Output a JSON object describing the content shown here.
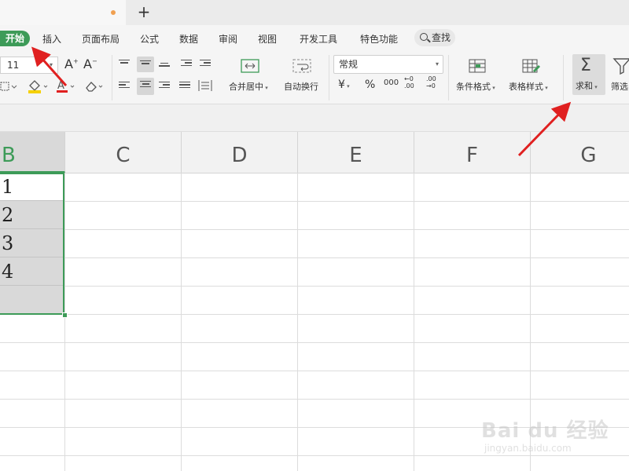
{
  "tabs": {
    "new_tab": "+"
  },
  "menu": {
    "home": "开始",
    "items": [
      "插入",
      "页面布局",
      "公式",
      "数据",
      "审阅",
      "视图",
      "开发工具",
      "特色功能"
    ],
    "search": "查找"
  },
  "ribbon": {
    "font_size": "11",
    "number_format": "常规",
    "merge_center": "合并居中",
    "wrap_text": "自动换行",
    "currency_symbol": "¥",
    "percent_symbol": "%",
    "thousands_symbol": "000",
    "inc_decimal": "←0 .00",
    "dec_decimal": ".00 →0",
    "conditional_format": "条件格式",
    "table_style": "表格样式",
    "sum": "求和",
    "filter": "筛选",
    "font_grow": "A",
    "font_shrink": "A"
  },
  "grid": {
    "columns": [
      "B",
      "C",
      "D",
      "E",
      "F",
      "G"
    ],
    "b_values": [
      "1",
      "2",
      "3",
      "4",
      ""
    ]
  },
  "watermark": {
    "main": "Bai du 经验",
    "sub": "jingyan.baidu.com"
  },
  "colors": {
    "accent": "#3d9b58",
    "annotation_arrow": "#e02020"
  }
}
